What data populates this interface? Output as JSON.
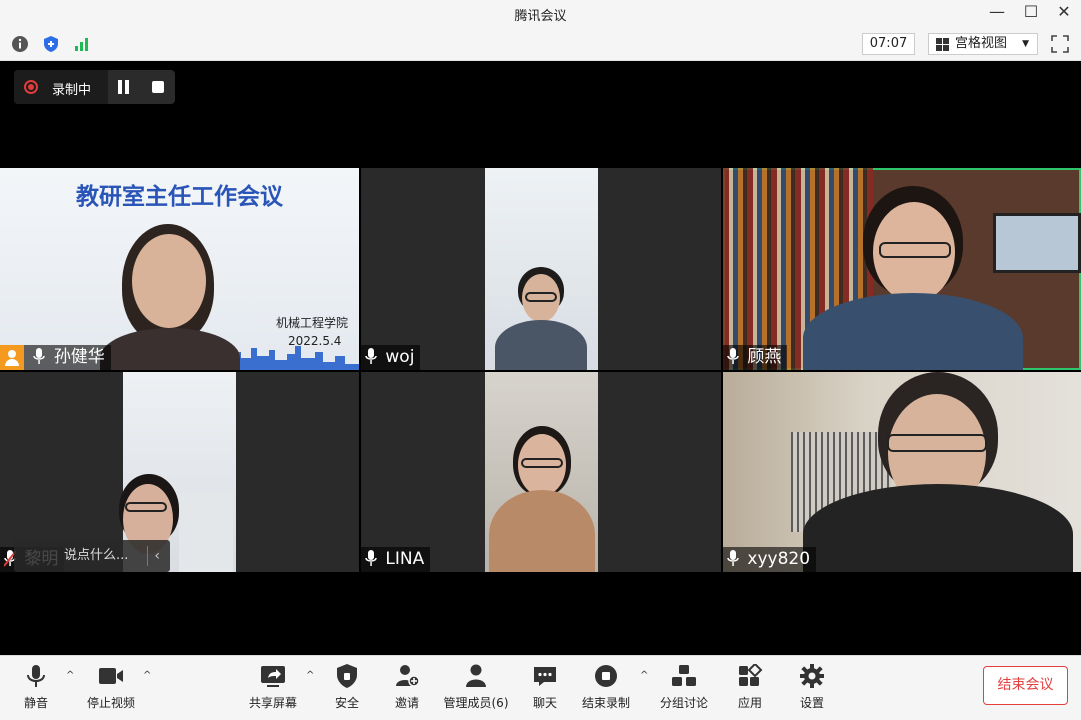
{
  "window": {
    "title": "腾讯会议",
    "minimize": "—",
    "maximize": "☐",
    "close": "✕"
  },
  "toolbar": {
    "timer": "07:07",
    "view_label": "宫格视图",
    "view_caret": "▼"
  },
  "recording": {
    "label": "录制中"
  },
  "slide": {
    "title": "教研室主任工作会议",
    "org": "机械工程学院",
    "date": "2022.5.4"
  },
  "participants": [
    {
      "name": "孙健华",
      "host": true,
      "muted": false
    },
    {
      "name": "woj",
      "muted": false
    },
    {
      "name": "顾燕",
      "muted": false,
      "speaking": true
    },
    {
      "name": "黎明",
      "muted": true
    },
    {
      "name": "LINA",
      "muted": false
    },
    {
      "name": "xyy820",
      "muted": false
    }
  ],
  "chat_prompt": {
    "text": "说点什么...",
    "arrow": "‹"
  },
  "bottom": {
    "mute": "静音",
    "stop_video": "停止视频",
    "share": "共享屏幕",
    "security": "安全",
    "invite": "邀请",
    "members": "管理成员(6)",
    "chat": "聊天",
    "end_record": "结束录制",
    "breakout": "分组讨论",
    "apps": "应用",
    "settings": "设置",
    "end_meeting": "结束会议",
    "caret": "^"
  },
  "colors": {
    "accent_green": "#2fc56a",
    "record_red": "#e23b3b",
    "end_red": "#e34040",
    "host_orange": "#f39a1f",
    "slide_title_blue": "#2a55b8"
  }
}
